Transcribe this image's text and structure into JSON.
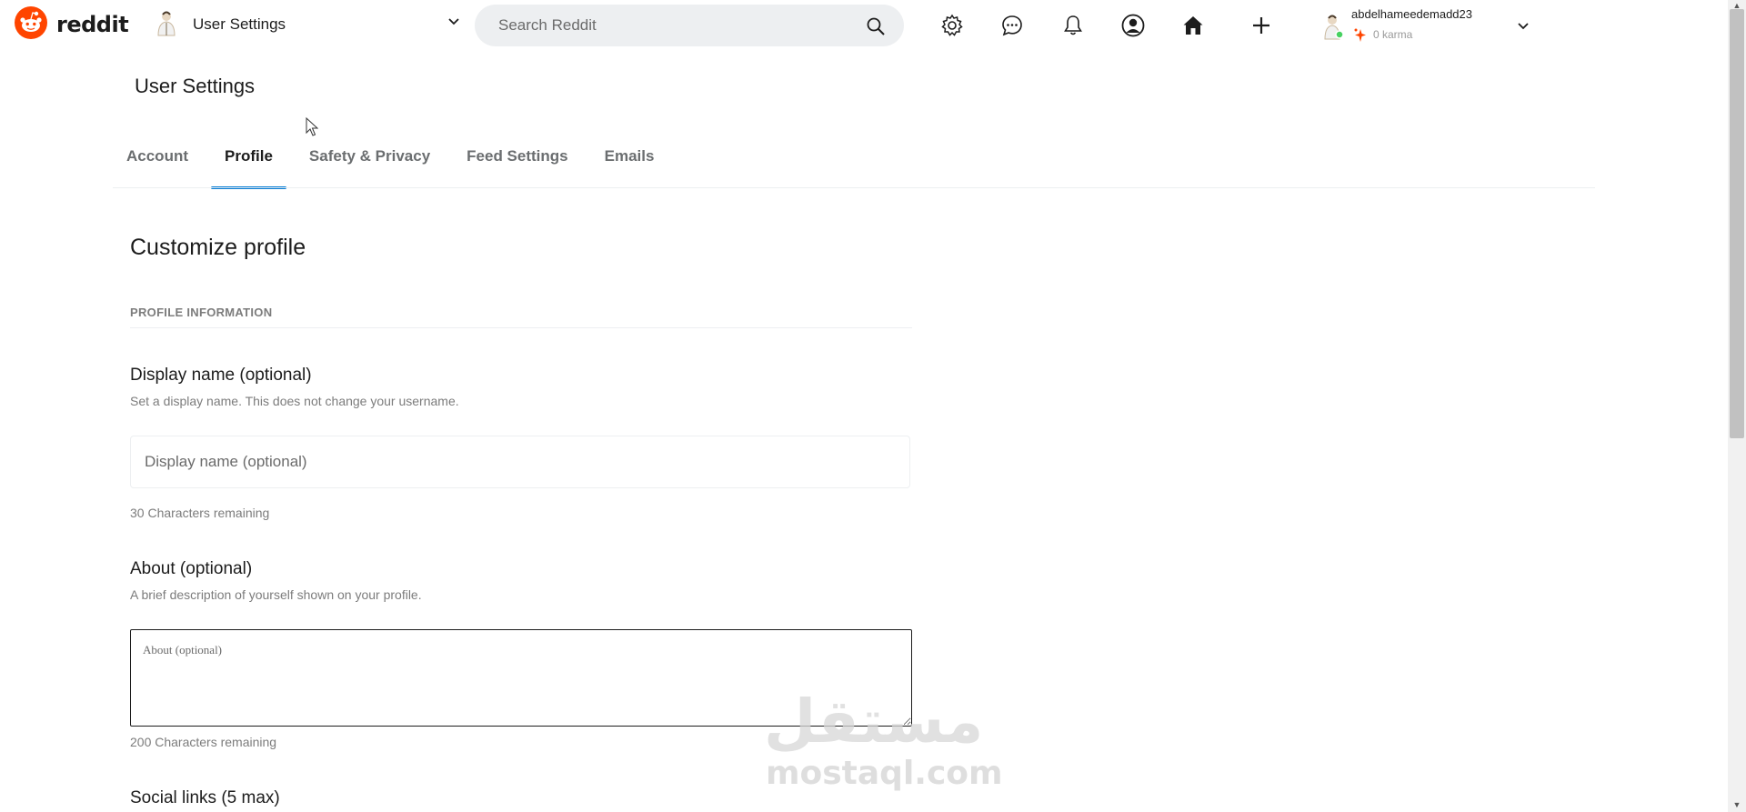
{
  "header": {
    "logo_text": "reddit",
    "community_title": "User Settings",
    "search_placeholder": "Search Reddit",
    "user": {
      "name": "abdelhameedemadd23",
      "karma": "0 karma"
    },
    "icons": [
      "settings-gear-icon",
      "chat-icon",
      "notification-bell-icon",
      "profile-icon",
      "home-icon",
      "plus-icon"
    ]
  },
  "page": {
    "title": "User Settings",
    "tabs": [
      {
        "label": "Account",
        "active": false
      },
      {
        "label": "Profile",
        "active": true
      },
      {
        "label": "Safety & Privacy",
        "active": false
      },
      {
        "label": "Feed Settings",
        "active": false
      },
      {
        "label": "Emails",
        "active": false
      }
    ]
  },
  "profile": {
    "section_title": "Customize profile",
    "section_subtitle": "PROFILE INFORMATION",
    "display_name": {
      "label": "Display name (optional)",
      "help": "Set a display name. This does not change your username.",
      "placeholder": "Display name (optional)",
      "remaining": "30 Characters remaining"
    },
    "about": {
      "label": "About (optional)",
      "help": "A brief description of yourself shown on your profile.",
      "placeholder": "About (optional)",
      "remaining": "200 Characters remaining"
    },
    "social_links_label": "Social links (5 max)"
  },
  "watermark": {
    "arabic": "مستقل",
    "latin": "mostaql.com"
  },
  "colors": {
    "brand": "#ff4500",
    "tab_active": "#0079d3",
    "text": "#1c1c1c",
    "muted": "#7c7c7c"
  }
}
